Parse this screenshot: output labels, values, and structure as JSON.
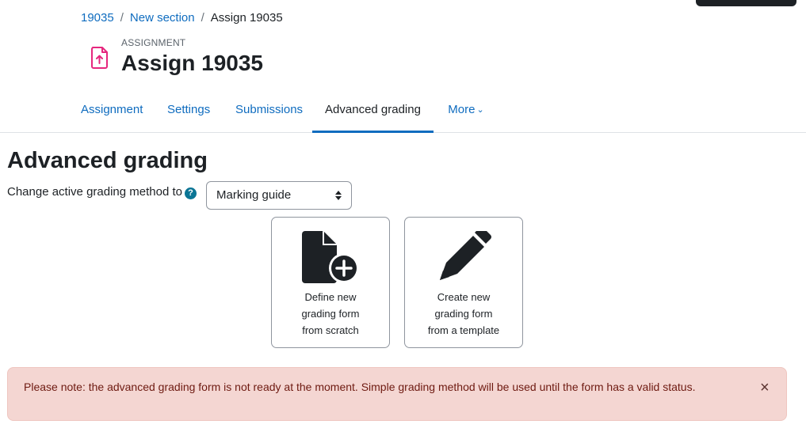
{
  "breadcrumb": {
    "items": [
      "19035",
      "New section"
    ],
    "separator": "/",
    "current": "Assign 19035"
  },
  "activity": {
    "type": "ASSIGNMENT",
    "title": "Assign 19035",
    "icon": "file-upload-icon",
    "icon_color": "#e6277e"
  },
  "tabs": [
    {
      "label": "Assignment"
    },
    {
      "label": "Settings"
    },
    {
      "label": "Submissions"
    },
    {
      "label": "Advanced grading",
      "active": true
    },
    {
      "label": "More",
      "icon": "chevron-down-icon"
    }
  ],
  "main": {
    "heading": "Advanced grading",
    "method_label": "Change active grading method to",
    "help_icon": "?",
    "method_select": {
      "value": "Marking guide"
    },
    "cards": [
      {
        "lines": [
          "Define new",
          "grading form",
          "from scratch"
        ],
        "icon": "file-plus-icon"
      },
      {
        "lines": [
          "Create new",
          "grading form",
          "from a template"
        ],
        "icon": "pencil-icon"
      }
    ]
  },
  "alert": {
    "text": "Please note: the advanced grading form is not ready at the moment. Simple grading method will be used until the form has a valid status.",
    "close": "×",
    "bg_color": "#f4d6d2"
  },
  "colors": {
    "link": "#0f6cbf",
    "text": "#1d2125"
  }
}
